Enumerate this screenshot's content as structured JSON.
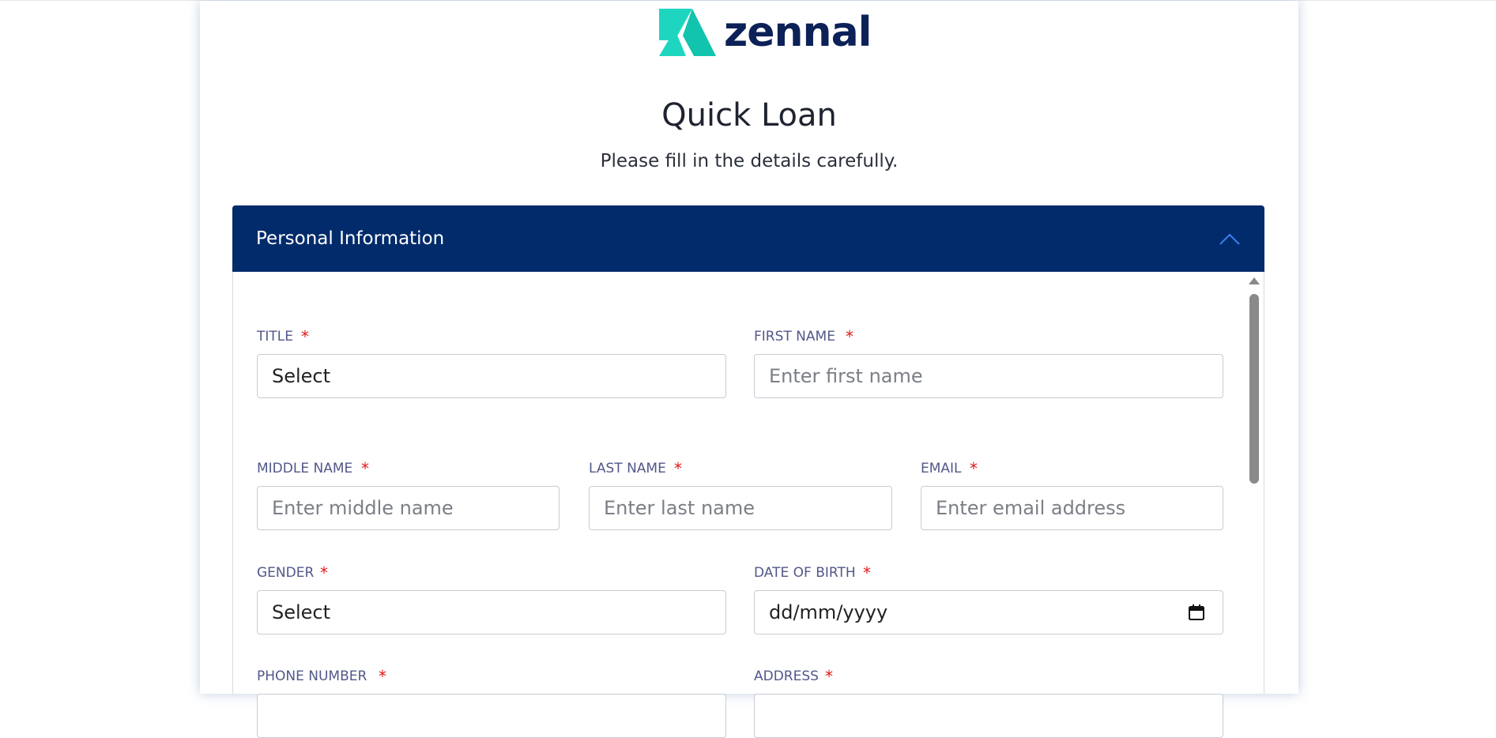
{
  "brand": {
    "name": "zennal",
    "mark_color": "#1ed6c0",
    "text_color": "#0b2157"
  },
  "page": {
    "title": "Quick Loan",
    "subtitle": "Please fill in the details carefully."
  },
  "section": {
    "title": "Personal Information",
    "header_color": "#022b6b",
    "expanded": true,
    "toggle_icon": "chevron-up-icon"
  },
  "fields": {
    "title": {
      "label": "TITLE",
      "value": "Select",
      "required": "*"
    },
    "first_name": {
      "label": "FIRST NAME",
      "placeholder": "Enter first name",
      "required": "*"
    },
    "middle_name": {
      "label": "MIDDLE NAME",
      "placeholder": "Enter middle name",
      "required": "*"
    },
    "last_name": {
      "label": "LAST NAME",
      "placeholder": "Enter last name",
      "required": "*"
    },
    "email": {
      "label": "EMAIL",
      "placeholder": "Enter email address",
      "required": "*"
    },
    "gender": {
      "label": "GENDER",
      "value": "Select",
      "required": "*"
    },
    "dob": {
      "label": "DATE OF BIRTH",
      "value": "dd/mm/yyyy",
      "required": "*",
      "icon": "calendar-icon"
    },
    "phone": {
      "label": "PHONE NUMBER",
      "required": "*"
    },
    "address": {
      "label": "ADDRESS",
      "required": "*"
    }
  },
  "colors": {
    "required": "#e01a1a",
    "label": "#515889"
  }
}
